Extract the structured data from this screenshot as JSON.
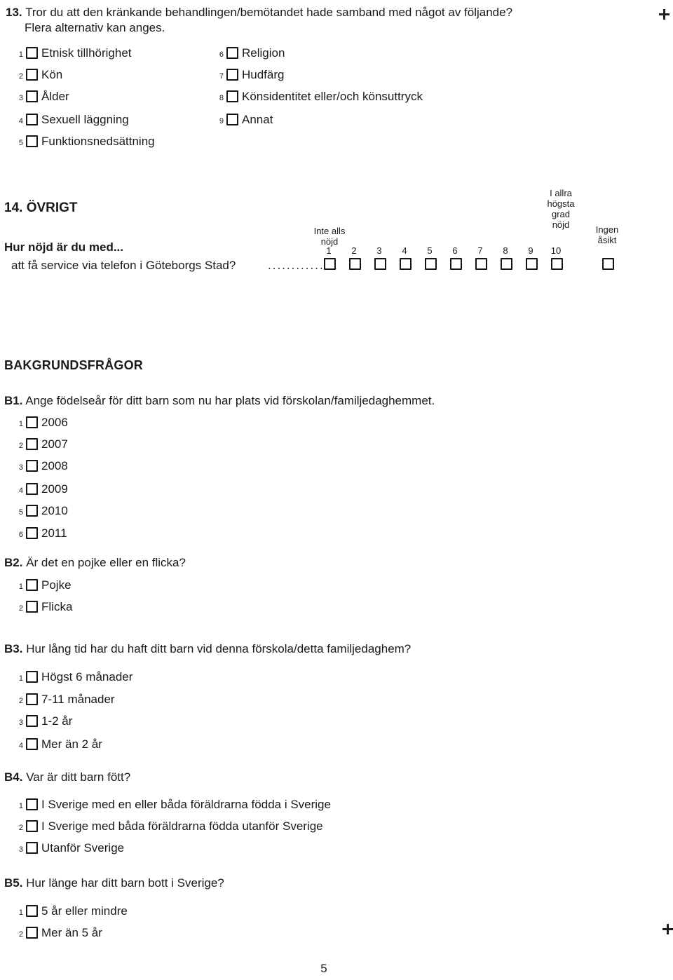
{
  "marks": {
    "top_right": "+",
    "bottom_right": "+"
  },
  "page_number": "5",
  "q13": {
    "number": "13.",
    "text": "Tror du att den kränkande behandlingen/bemötandet hade samband med något av följande?",
    "subtext": "Flera alternativ kan anges.",
    "options_left": [
      {
        "num": "1",
        "label": "Etnisk tillhörighet"
      },
      {
        "num": "2",
        "label": "Kön"
      },
      {
        "num": "3",
        "label": "Ålder"
      },
      {
        "num": "4",
        "label": "Sexuell läggning"
      },
      {
        "num": "5",
        "label": "Funktionsnedsättning"
      }
    ],
    "options_right": [
      {
        "num": "6",
        "label": "Religion"
      },
      {
        "num": "7",
        "label": "Hudfärg"
      },
      {
        "num": "8",
        "label": "Könsidentitet eller/och könsuttryck"
      },
      {
        "num": "9",
        "label": "Annat"
      }
    ]
  },
  "q14": {
    "title": "14. ÖVRIGT",
    "lead": "Hur nöjd är du med...",
    "item": "att få service via telefon i Göteborgs Stad?",
    "leader_dots": "...............",
    "anchor_low": "Inte alls\nnöjd",
    "anchor_low_line1": "Inte alls",
    "anchor_low_line2": "nöjd",
    "anchor_high_line1": "I allra",
    "anchor_high_line2": "högsta",
    "anchor_high_line3": "grad",
    "anchor_high_line4": "nöjd",
    "no_opinion_line1": "Ingen",
    "no_opinion_line2": "åsikt",
    "scale": [
      "1",
      "2",
      "3",
      "4",
      "5",
      "6",
      "7",
      "8",
      "9",
      "10"
    ]
  },
  "background": {
    "heading": "BAKGRUNDSFRÅGOR",
    "b1": {
      "number": "B1.",
      "text": "Ange födelseår för ditt barn som nu har plats vid förskolan/familjedaghemmet.",
      "options": [
        {
          "num": "1",
          "label": "2006"
        },
        {
          "num": "2",
          "label": "2007"
        },
        {
          "num": "3",
          "label": "2008"
        },
        {
          "num": "4",
          "label": "2009"
        },
        {
          "num": "5",
          "label": "2010"
        },
        {
          "num": "6",
          "label": "2011"
        }
      ]
    },
    "b2": {
      "number": "B2.",
      "text": "Är det en pojke eller en flicka?",
      "options": [
        {
          "num": "1",
          "label": "Pojke"
        },
        {
          "num": "2",
          "label": "Flicka"
        }
      ]
    },
    "b3": {
      "number": "B3.",
      "text": "Hur lång tid har du haft ditt barn vid denna förskola/detta familjedaghem?",
      "options": [
        {
          "num": "1",
          "label": "Högst 6 månader"
        },
        {
          "num": "2",
          "label": "7-11 månader"
        },
        {
          "num": "3",
          "label": "1-2 år"
        },
        {
          "num": "4",
          "label": "Mer än 2 år"
        }
      ]
    },
    "b4": {
      "number": "B4.",
      "text": "Var är ditt barn fött?",
      "options": [
        {
          "num": "1",
          "label": "I Sverige med en eller båda föräldrarna födda i Sverige"
        },
        {
          "num": "2",
          "label": "I Sverige med båda föräldrarna födda utanför Sverige"
        },
        {
          "num": "3",
          "label": "Utanför Sverige"
        }
      ]
    },
    "b5": {
      "number": "B5.",
      "text": "Hur länge har ditt barn bott i Sverige?",
      "options": [
        {
          "num": "1",
          "label": "5 år eller mindre"
        },
        {
          "num": "2",
          "label": "Mer än 5 år"
        }
      ]
    }
  }
}
